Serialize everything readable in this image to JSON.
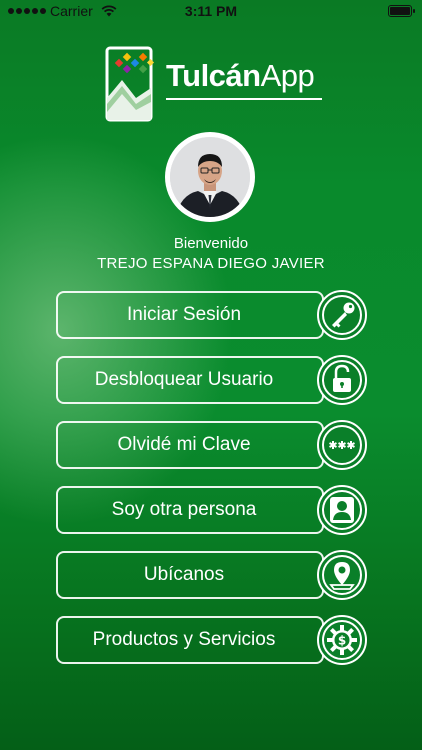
{
  "status_bar": {
    "carrier": "Carrier",
    "time": "3:11 PM"
  },
  "logo": {
    "name_bold": "Tulcán",
    "name_light": "App"
  },
  "profile": {
    "welcome": "Bienvenido",
    "name": "TREJO ESPANA DIEGO JAVIER"
  },
  "menu": [
    {
      "label": "Iniciar Sesión",
      "icon": "key-icon"
    },
    {
      "label": "Desbloquear Usuario",
      "icon": "unlock-icon"
    },
    {
      "label": "Olvidé mi Clave",
      "icon": "password-icon"
    },
    {
      "label": "Soy otra persona",
      "icon": "user-icon"
    },
    {
      "label": "Ubícanos",
      "icon": "location-pin-icon"
    },
    {
      "label": "Productos y Servicios",
      "icon": "gear-dollar-icon"
    }
  ],
  "colors": {
    "background": "#098a2c",
    "foreground": "#ffffff"
  }
}
